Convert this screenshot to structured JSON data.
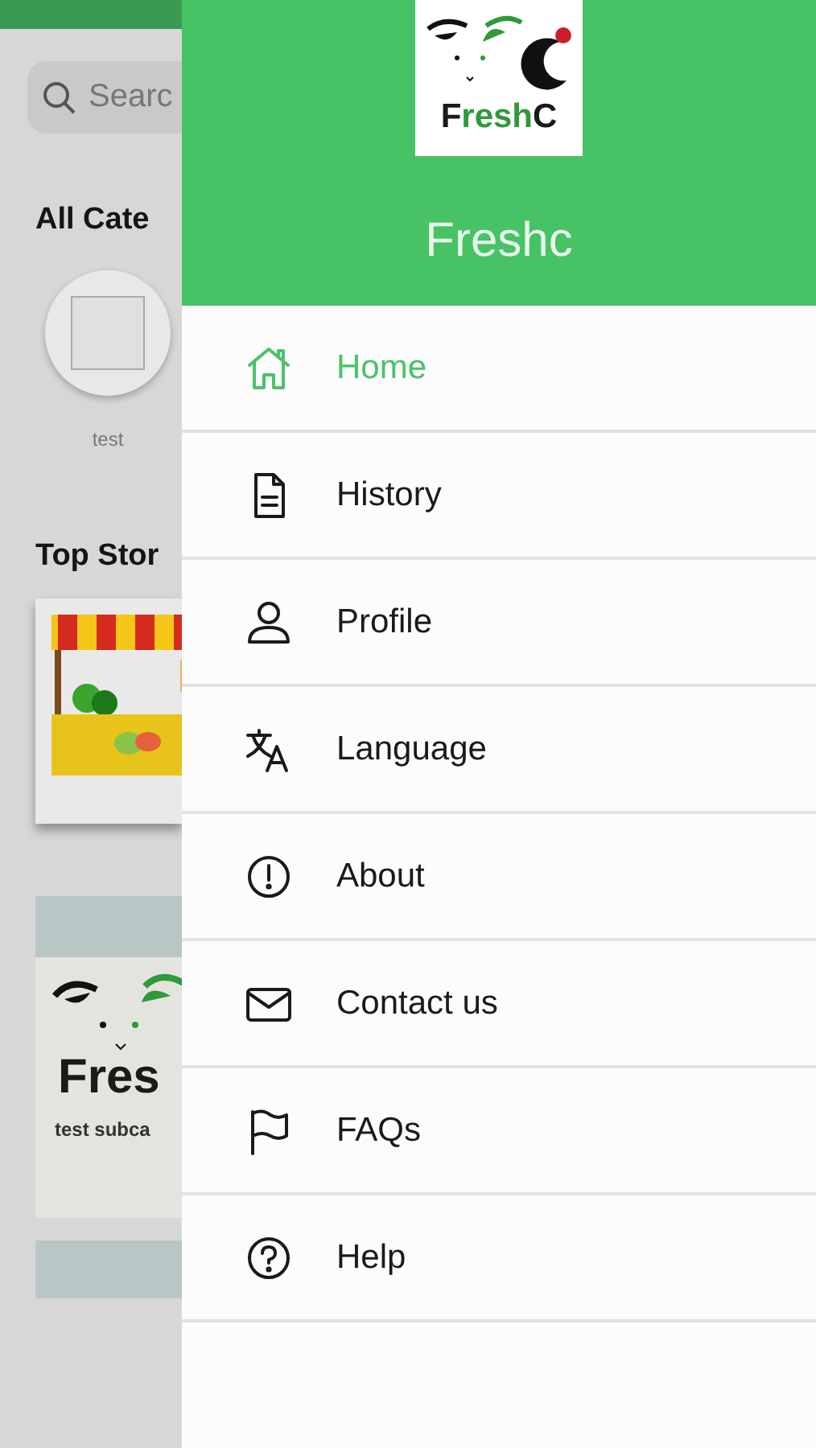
{
  "background": {
    "search": {
      "placeholder": "Searc"
    },
    "categories_title": "All Cate",
    "categories": [
      {
        "label": "test"
      }
    ],
    "stores_title": "Top Stor",
    "subcategory": {
      "logo_parts": [
        {
          "text": "Fres",
          "color": "#1a1a1a"
        }
      ],
      "label": "test subca"
    }
  },
  "drawer": {
    "logo_parts": [
      {
        "text": "F",
        "color": "#1a1a1a"
      },
      {
        "text": "resh",
        "color": "#2e9a3a"
      },
      {
        "text": "C",
        "color": "#1a1a1a"
      }
    ],
    "title": "Freshc",
    "items": [
      {
        "kind": "home",
        "label": "Home",
        "selected": true
      },
      {
        "kind": "history",
        "label": "History",
        "selected": false
      },
      {
        "kind": "profile",
        "label": "Profile",
        "selected": false
      },
      {
        "kind": "language",
        "label": "Language",
        "selected": false
      },
      {
        "kind": "about",
        "label": "About",
        "selected": false
      },
      {
        "kind": "contact",
        "label": "Contact us",
        "selected": false
      },
      {
        "kind": "faqs",
        "label": "FAQs",
        "selected": false
      },
      {
        "kind": "help",
        "label": "Help",
        "selected": false
      }
    ]
  }
}
